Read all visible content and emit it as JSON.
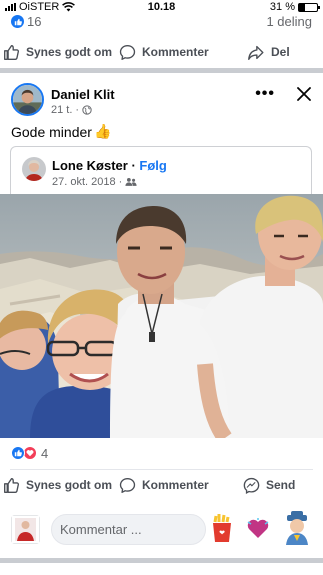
{
  "status_bar": {
    "carrier": "OiSTER",
    "time": "10.18",
    "battery": "31 %",
    "battery_level": 0.31
  },
  "previous_post": {
    "reaction_count": "16",
    "shares": "1 deling",
    "actions": {
      "like": "Synes godt om",
      "comment": "Kommenter",
      "share": "Del"
    }
  },
  "post": {
    "author": "Daniel Klit",
    "time": "21 t.",
    "privacy_icon": "globe-icon",
    "text": "Gode minder",
    "emoji": "👍",
    "shared": {
      "author": "Lone Køster",
      "separator": " · ",
      "follow": "Følg",
      "date": "27. okt. 2018",
      "separator2": " · ",
      "audience_icon": "friends-icon"
    },
    "reactions": {
      "count": "4",
      "types": [
        "like",
        "love"
      ]
    },
    "actions": {
      "like": "Synes godt om",
      "comment": "Kommenter",
      "send": "Send"
    },
    "comment_placeholder": "Kommentar ..."
  },
  "colors": {
    "facebook_blue": "#1877f2",
    "love_red": "#f33e58",
    "divider": "#c9ccd1",
    "secondary_text": "#65676b"
  }
}
